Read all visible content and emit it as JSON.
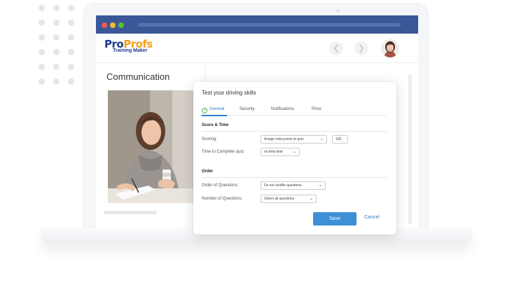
{
  "colors": {
    "browser_bar": "#3a5797",
    "accent": "#3d8fd6",
    "link": "#2f7cc8",
    "success": "#4caf50"
  },
  "logo": {
    "name_part1": "Pro",
    "name_part2": "Profs",
    "subtitle": "Training Maker"
  },
  "header": {
    "back_icon": "chevron-left-icon",
    "forward_icon": "chevron-right-icon"
  },
  "page": {
    "title": "Communication"
  },
  "modal": {
    "title": "Test your driving skills",
    "tabs": [
      {
        "label": "General",
        "active": true,
        "icon": "check-circle-icon"
      },
      {
        "label": "Security"
      },
      {
        "label": "Notifications"
      },
      {
        "label": "Price"
      }
    ],
    "sections": {
      "score_time": {
        "title": "Score & Time",
        "scoring_label": "Scoring:",
        "scoring_value": "Assign total points to quiz",
        "points_value": "100",
        "time_label": "Time to Complete quiz:",
        "time_value": "no time limit"
      },
      "order": {
        "title": "Order",
        "order_label": "Order of Questions:",
        "order_value": "Do not shuffle questions",
        "number_label": "Number of Questions:",
        "number_value": "Select all questions"
      }
    },
    "save_label": "Save",
    "cancel_label": "Cancel"
  }
}
